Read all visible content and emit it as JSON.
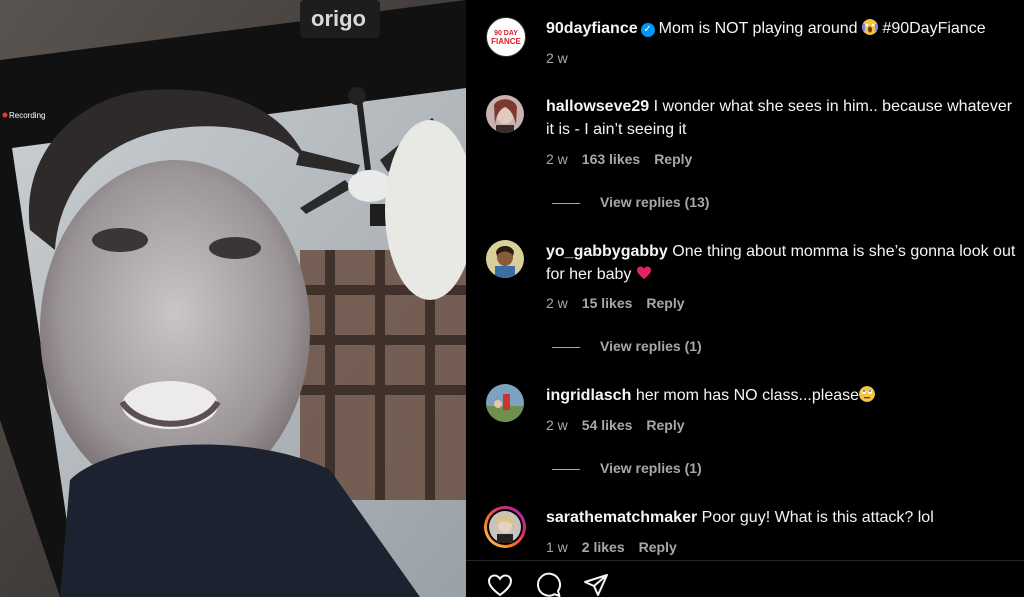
{
  "media": {
    "watermark": "origo",
    "recording_label": "Recording"
  },
  "post": {
    "username": "90dayfiance",
    "avatar_text": "90 DAY FIANCE",
    "caption": "Mom is NOT playing around",
    "hashtag": "#90DayFiance",
    "time": "2 w"
  },
  "comments": [
    {
      "username": "hallowseve29",
      "text": "I wonder what she sees in him.. because whatever it is - I ain’t seeing it",
      "time": "2 w",
      "likes": "163 likes",
      "reply": "Reply",
      "view_replies": "View replies (13)"
    },
    {
      "username": "yo_gabbygabby",
      "text": "One thing about momma is she’s gonna look out for her baby",
      "time": "2 w",
      "likes": "15 likes",
      "reply": "Reply",
      "view_replies": "View replies (1)"
    },
    {
      "username": "ingridlasch",
      "text": "her mom has NO class...please",
      "time": "2 w",
      "likes": "54 likes",
      "reply": "Reply",
      "view_replies": "View replies (1)"
    },
    {
      "username": "sarathematchmaker",
      "text": "Poor guy! What is this attack? lol",
      "time": "1 w",
      "likes": "2 likes",
      "reply": "Reply"
    }
  ],
  "icons": {
    "like": "heart-icon",
    "comment": "comment-icon",
    "share": "share-icon",
    "verified": "verified-badge-icon"
  },
  "colors": {
    "background": "#000000",
    "text": "#f5f5f5",
    "secondary": "#a8a8a8",
    "verified": "#0095f6",
    "heart": "#e0245e"
  }
}
